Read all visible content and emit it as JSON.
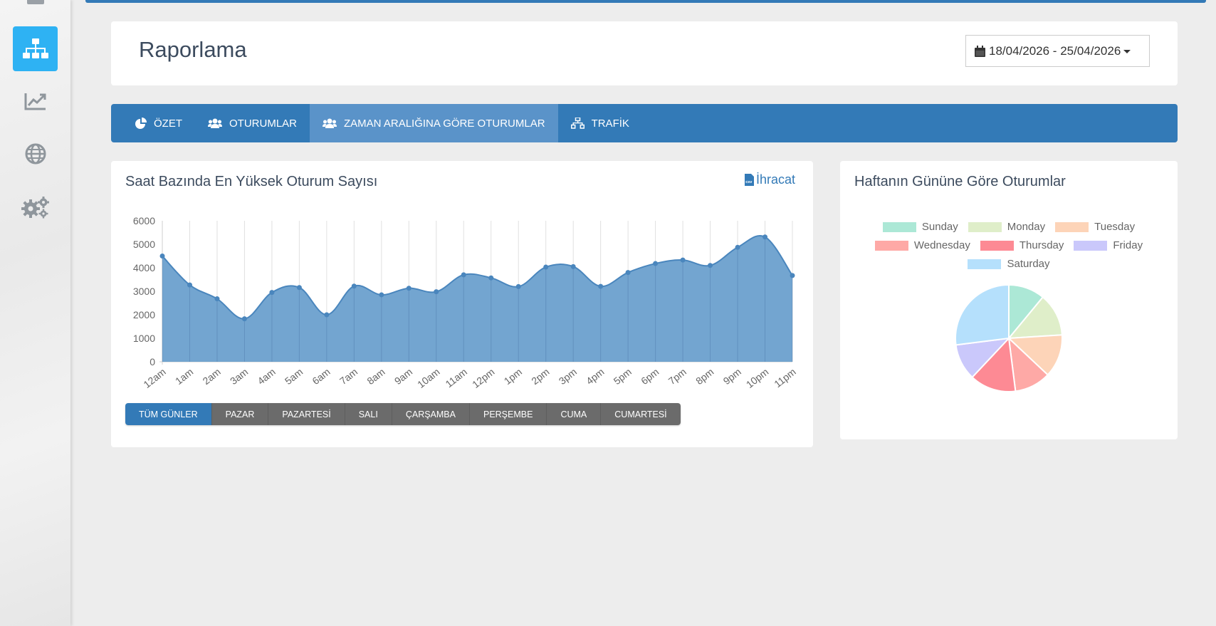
{
  "header": {
    "title": "Raporlama",
    "date_range": "18/04/2026 - 25/04/2026"
  },
  "sidebar": {
    "items": [
      {
        "name": "sitemap",
        "icon": "sitemap-icon",
        "active": true
      },
      {
        "name": "chart",
        "icon": "line-chart-icon",
        "active": false
      },
      {
        "name": "globe",
        "icon": "globe-icon",
        "active": false
      },
      {
        "name": "settings",
        "icon": "gears-icon",
        "active": false
      }
    ]
  },
  "tabs": [
    {
      "label": "ÖZET",
      "icon": "pie-chart-icon",
      "active": false
    },
    {
      "label": "OTURUMLAR",
      "icon": "users-icon",
      "active": false
    },
    {
      "label": "ZAMAN ARALIĞINA GÖRE OTURUMLAR",
      "icon": "users-icon",
      "active": true
    },
    {
      "label": "TRAFİK",
      "icon": "sitemap-icon",
      "active": false
    }
  ],
  "hourly_panel": {
    "title": "Saat Bazında En Yüksek Oturum Sayısı",
    "export_label": "İhracat",
    "day_filters": [
      {
        "label": "TÜM GÜNLER",
        "active": true
      },
      {
        "label": "PAZAR",
        "active": false
      },
      {
        "label": "PAZARTESİ",
        "active": false
      },
      {
        "label": "SALI",
        "active": false
      },
      {
        "label": "ÇARŞAMBA",
        "active": false
      },
      {
        "label": "PERŞEMBE",
        "active": false
      },
      {
        "label": "CUMA",
        "active": false
      },
      {
        "label": "CUMARTESİ",
        "active": false
      }
    ]
  },
  "weekday_panel": {
    "title": "Haftanın Gününe Göre Oturumlar"
  },
  "chart_data": [
    {
      "type": "area",
      "title": "Saat Bazında En Yüksek Oturum Sayısı",
      "categories": [
        "12am",
        "1am",
        "2am",
        "3am",
        "4am",
        "5am",
        "6am",
        "7am",
        "8am",
        "9am",
        "10am",
        "11am",
        "12pm",
        "1pm",
        "2pm",
        "3pm",
        "4pm",
        "5pm",
        "6pm",
        "7pm",
        "8pm",
        "9pm",
        "10pm",
        "11pm"
      ],
      "series": [
        {
          "values": [
            4500,
            3270,
            2680,
            1830,
            2950,
            3160,
            2000,
            3220,
            2850,
            3130,
            2980,
            3700,
            3570,
            3200,
            4030,
            4050,
            3210,
            3800,
            4180,
            4330,
            4100,
            4870,
            5310,
            3670
          ],
          "color": "#5b95c8"
        }
      ],
      "ylim": [
        0,
        6000
      ],
      "yticks": [
        0,
        1000,
        2000,
        3000,
        4000,
        5000,
        6000
      ],
      "grid": "vertical"
    },
    {
      "type": "pie",
      "title": "Haftanın Gününe Göre Oturumlar",
      "legend_position": "top",
      "labels": [
        "Sunday",
        "Monday",
        "Tuesday",
        "Wednesday",
        "Thursday",
        "Friday",
        "Saturday"
      ],
      "values": [
        11,
        13,
        13,
        11,
        14,
        11,
        27
      ],
      "colors": [
        "#ace8d6",
        "#dfeec9",
        "#fdd4b8",
        "#fea9a6",
        "#fd8a94",
        "#cac8fb",
        "#b5e0fc"
      ]
    }
  ]
}
